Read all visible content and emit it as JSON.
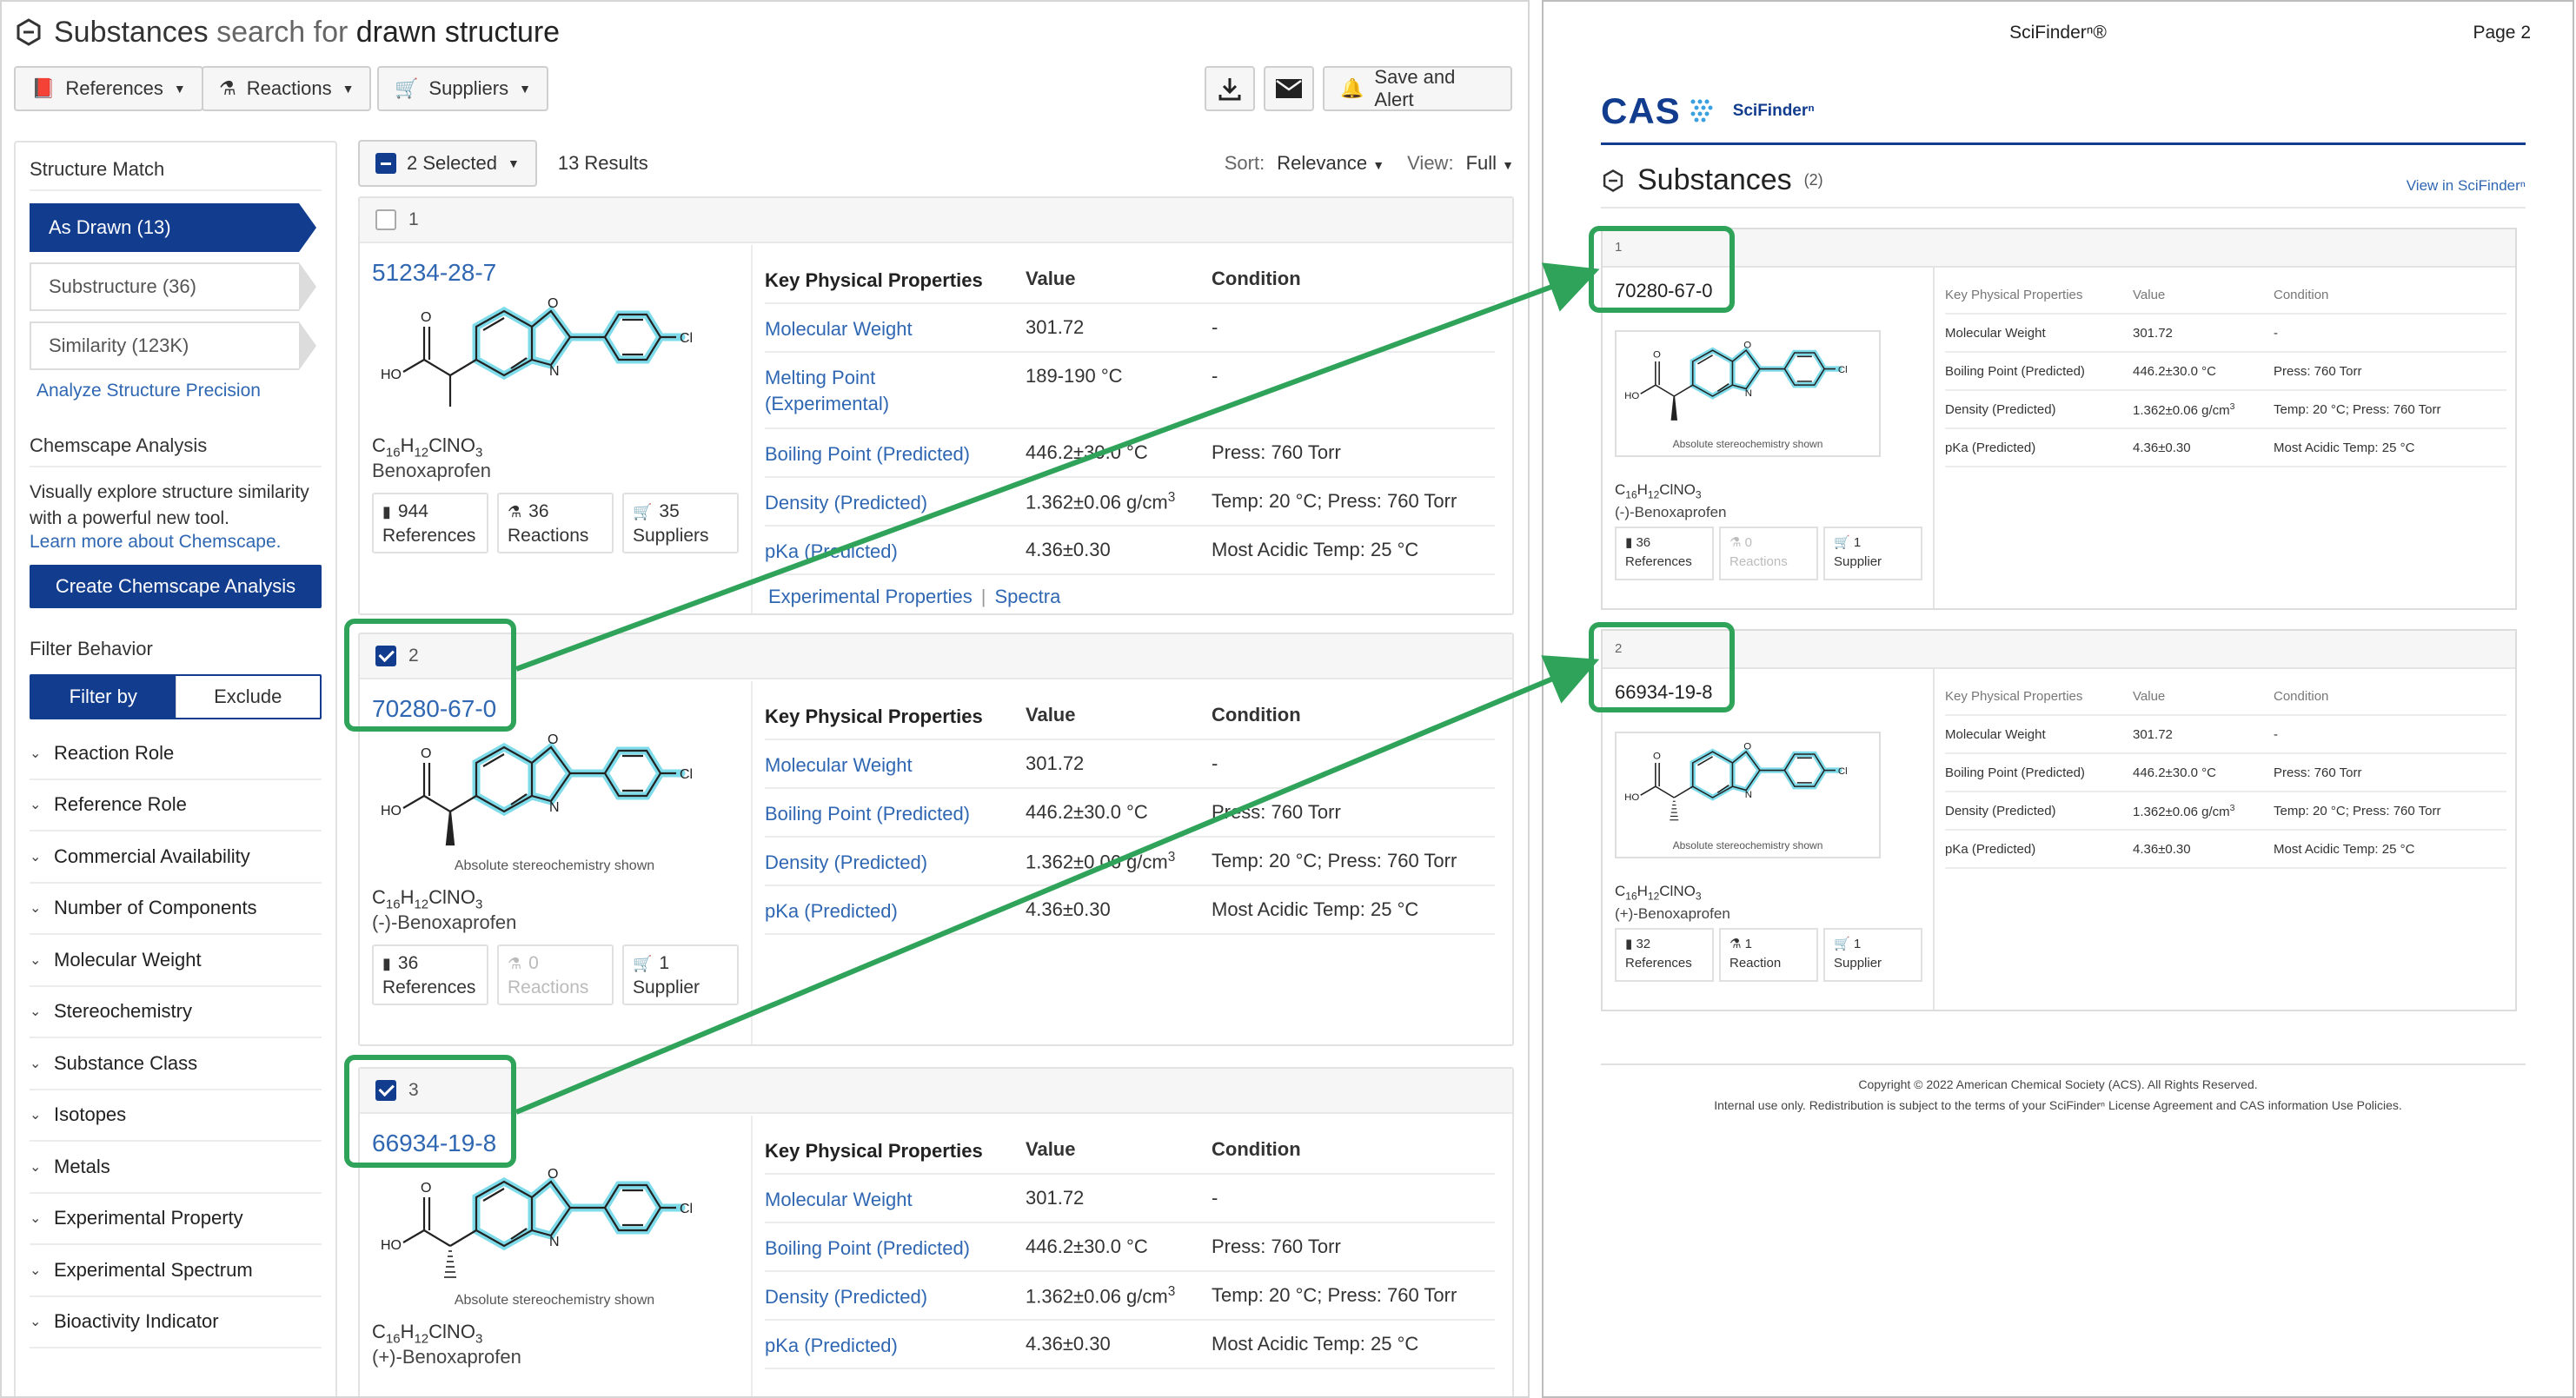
{
  "app": {
    "title_prefix": "Substances",
    "title_mid": "search for",
    "title_suffix": "drawn structure",
    "toolbar": {
      "references": "References",
      "reactions": "Reactions",
      "suppliers": "Suppliers",
      "save_alert": "Save and Alert",
      "download_icon": "download-icon",
      "email_icon": "envelope-icon"
    }
  },
  "sidebar": {
    "structure_match_heading": "Structure Match",
    "match_options": [
      "As Drawn (13)",
      "Substructure (36)",
      "Similarity (123K)"
    ],
    "analyze_link": "Analyze Structure Precision",
    "chemscape_heading": "Chemscape Analysis",
    "chemscape_text": "Visually explore structure similarity with a powerful new tool.",
    "chemscape_link": "Learn more about Chemscape.",
    "chemscape_button": "Create Chemscape Analysis",
    "filter_behavior_heading": "Filter Behavior",
    "filter_by": "Filter by",
    "exclude": "Exclude",
    "filters": [
      "Reaction Role",
      "Reference Role",
      "Commercial Availability",
      "Number of Components",
      "Molecular Weight",
      "Stereochemistry",
      "Substance Class",
      "Isotopes",
      "Metals",
      "Experimental Property",
      "Experimental Spectrum",
      "Bioactivity Indicator"
    ]
  },
  "results_bar": {
    "selected": "2 Selected",
    "count": "13 Results",
    "sort_label": "Sort:",
    "sort_value": "Relevance",
    "view_label": "View:",
    "view_value": "Full"
  },
  "props_headers": {
    "property": "Key Physical Properties",
    "value": "Value",
    "condition": "Condition"
  },
  "results": [
    {
      "index": "1",
      "checked": false,
      "cas": "51234-28-7",
      "stereo": "",
      "formula": {
        "c": "C",
        "c_n": "16",
        "h": "H",
        "h_n": "12",
        "rest": "ClNO",
        "o_n": "3"
      },
      "name": "Benoxaprofen",
      "badges": [
        {
          "count": "944",
          "label": "References",
          "icon": "book-icon"
        },
        {
          "count": "36",
          "label": "Reactions",
          "icon": "flask-icon"
        },
        {
          "count": "35",
          "label": "Suppliers",
          "icon": "cart-icon"
        }
      ],
      "props": [
        {
          "p": "Molecular Weight",
          "v": "301.72",
          "c": "-"
        },
        {
          "p": "Melting Point (Experimental)",
          "v": "189-190 °C",
          "c": "-"
        },
        {
          "p": "Boiling Point (Predicted)",
          "v": "446.2±30.0 °C",
          "c": "Press: 760 Torr"
        },
        {
          "p": "Density (Predicted)",
          "v": "1.362±0.06 g/cm3",
          "c": "Temp: 20 °C; Press: 760 Torr"
        },
        {
          "p": "pKa (Predicted)",
          "v": "4.36±0.30",
          "c": "Most Acidic Temp: 25 °C"
        }
      ],
      "foot_links": [
        "Experimental Properties",
        "Spectra"
      ]
    },
    {
      "index": "2",
      "checked": true,
      "cas": "70280-67-0",
      "stereo": "Absolute stereochemistry shown",
      "formula": {
        "c": "C",
        "c_n": "16",
        "h": "H",
        "h_n": "12",
        "rest": "ClNO",
        "o_n": "3"
      },
      "name": "(-)-Benoxaprofen",
      "badges": [
        {
          "count": "36",
          "label": "References",
          "icon": "book-icon"
        },
        {
          "count": "0",
          "label": "Reactions",
          "icon": "flask-icon",
          "disabled": true
        },
        {
          "count": "1",
          "label": "Supplier",
          "icon": "cart-icon"
        }
      ],
      "props": [
        {
          "p": "Molecular Weight",
          "v": "301.72",
          "c": "-"
        },
        {
          "p": "Boiling Point (Predicted)",
          "v": "446.2±30.0 °C",
          "c": "Press: 760 Torr"
        },
        {
          "p": "Density (Predicted)",
          "v": "1.362±0.06 g/cm3",
          "c": "Temp: 20 °C; Press: 760 Torr"
        },
        {
          "p": "pKa (Predicted)",
          "v": "4.36±0.30",
          "c": "Most Acidic Temp: 25 °C"
        }
      ]
    },
    {
      "index": "3",
      "checked": true,
      "cas": "66934-19-8",
      "stereo": "Absolute stereochemistry shown",
      "formula": {
        "c": "C",
        "c_n": "16",
        "h": "H",
        "h_n": "12",
        "rest": "ClNO",
        "o_n": "3"
      },
      "name": "(+)-Benoxaprofen",
      "props": [
        {
          "p": "Molecular Weight",
          "v": "301.72",
          "c": "-"
        },
        {
          "p": "Boiling Point (Predicted)",
          "v": "446.2±30.0 °C",
          "c": "Press: 760 Torr"
        },
        {
          "p": "Density (Predicted)",
          "v": "1.362±0.06 g/cm3",
          "c": "Temp: 20 °C; Press: 760 Torr"
        },
        {
          "p": "pKa (Predicted)",
          "v": "4.36±0.30",
          "c": "Most Acidic Temp: 25 °C"
        }
      ]
    }
  ],
  "pdf": {
    "header": "SciFinderⁿ®",
    "page": "Page 2",
    "logo_cas": "CAS",
    "logo_scifinder": "SciFinderⁿ",
    "section_title": "Substances",
    "section_count": "(2)",
    "view_link": "View in SciFinderⁿ",
    "cards": [
      {
        "index": "1",
        "cas": "70280-67-0",
        "stereo": "Absolute stereochemistry shown",
        "name": "(-)-Benoxaprofen",
        "badges": [
          {
            "count": "36",
            "label": "References"
          },
          {
            "count": "0",
            "label": "Reactions",
            "disabled": true
          },
          {
            "count": "1",
            "label": "Supplier"
          }
        ]
      },
      {
        "index": "2",
        "cas": "66934-19-8",
        "stereo": "Absolute stereochemistry shown",
        "name": "(+)-Benoxaprofen",
        "badges": [
          {
            "count": "32",
            "label": "References"
          },
          {
            "count": "1",
            "label": "Reaction"
          },
          {
            "count": "1",
            "label": "Supplier"
          }
        ]
      }
    ],
    "footer_line1": "Copyright © 2022 American Chemical Society (ACS). All Rights Reserved.",
    "footer_line2": "Internal use only. Redistribution is subject to the terms of your SciFinderⁿ License Agreement and CAS information Use Policies."
  },
  "colors": {
    "brand": "#123d8f",
    "link": "#2f67b2",
    "highlight": "#2fa35a",
    "molecule_glow": "#5fd3e6"
  }
}
